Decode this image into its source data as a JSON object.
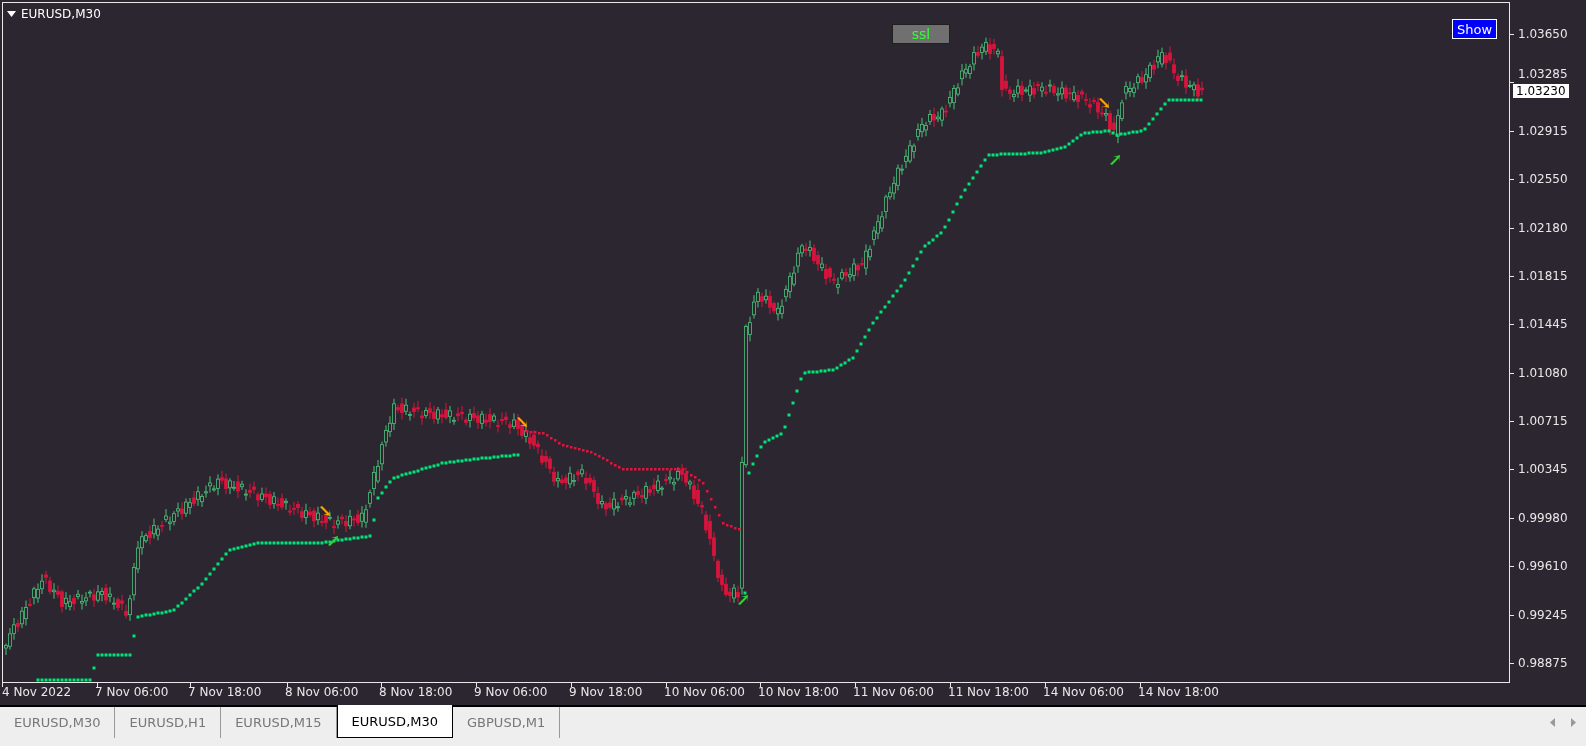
{
  "chart": {
    "title": "EURUSD,M30",
    "indicator_button": "ssl",
    "show_button": "Show",
    "current_price": "1.03230"
  },
  "price_axis": {
    "labels": [
      "1.03650",
      "1.03285",
      "1.02915",
      "1.02550",
      "1.02180",
      "1.01815",
      "1.01445",
      "1.01080",
      "1.00715",
      "1.00345",
      "0.99980",
      "0.99610",
      "0.99245",
      "0.98875"
    ]
  },
  "time_axis": {
    "labels": [
      "4 Nov 2022",
      "7 Nov 06:00",
      "7 Nov 18:00",
      "8 Nov 06:00",
      "8 Nov 18:00",
      "9 Nov 06:00",
      "9 Nov 18:00",
      "10 Nov 06:00",
      "10 Nov 18:00",
      "11 Nov 06:00",
      "11 Nov 18:00",
      "14 Nov 06:00",
      "14 Nov 18:00"
    ]
  },
  "tabs": [
    {
      "label": "EURUSD,M30",
      "selected": false
    },
    {
      "label": "EURUSD,H1",
      "selected": false
    },
    {
      "label": "EURUSD,M15",
      "selected": false
    },
    {
      "label": "EURUSD,M30",
      "selected": true
    },
    {
      "label": "GBPUSD,M1",
      "selected": false
    }
  ]
}
